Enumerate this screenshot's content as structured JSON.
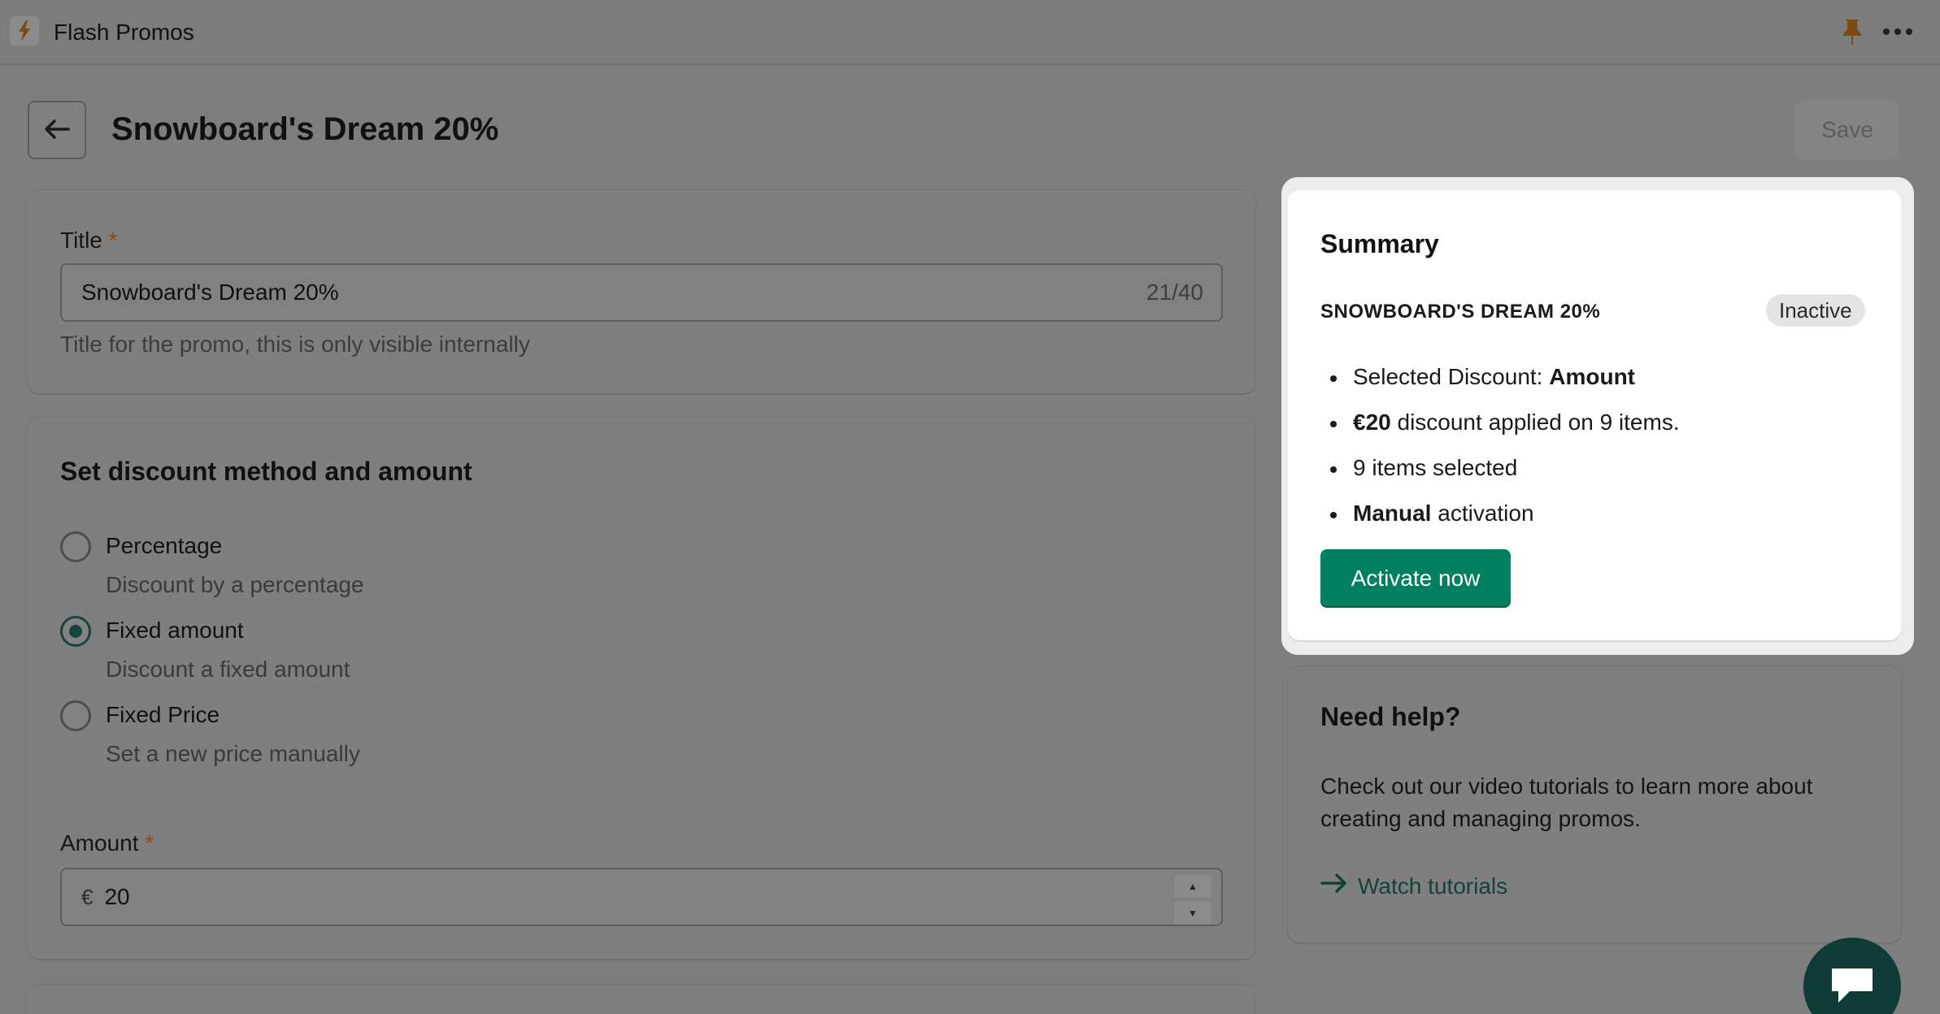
{
  "app": {
    "title": "Flash Promos",
    "icon": "lightning-icon",
    "pin_icon": "pin-icon",
    "menu_icon": "more-icon"
  },
  "header": {
    "title": "Snowboard's Dream 20%",
    "save_label": "Save"
  },
  "title_card": {
    "label": "Title",
    "required_mark": "*",
    "value": "Snowboard's Dream 20%",
    "char_count": "21/40",
    "hint": "Title for the promo, this is only visible internally"
  },
  "discount_card": {
    "heading": "Set discount method and amount",
    "options": [
      {
        "label": "Percentage",
        "description": "Discount by a percentage",
        "checked": false
      },
      {
        "label": "Fixed amount",
        "description": "Discount a fixed amount",
        "checked": true
      },
      {
        "label": "Fixed Price",
        "description": "Set a new price manually",
        "checked": false
      }
    ],
    "amount_label": "Amount",
    "amount_required_mark": "*",
    "currency_prefix": "€",
    "amount_value": "20"
  },
  "summary": {
    "heading": "Summary",
    "promo_name": "SNOWBOARD'S DREAM 20%",
    "status": "Inactive",
    "lines": {
      "l1_prefix": "Selected Discount: ",
      "l1_bold": "Amount",
      "l2_bold": "€20",
      "l2_suffix": " discount applied on 9 items.",
      "l3": "9 items selected",
      "l4_bold": "Manual",
      "l4_suffix": " activation"
    },
    "activate_label": "Activate now"
  },
  "help": {
    "heading": "Need help?",
    "text": "Check out our video tutorials to learn more about creating and managing promos.",
    "link_label": "Watch tutorials"
  },
  "colors": {
    "primary": "#008060",
    "overlay": "#7e7e7e",
    "link": "#17403a"
  }
}
